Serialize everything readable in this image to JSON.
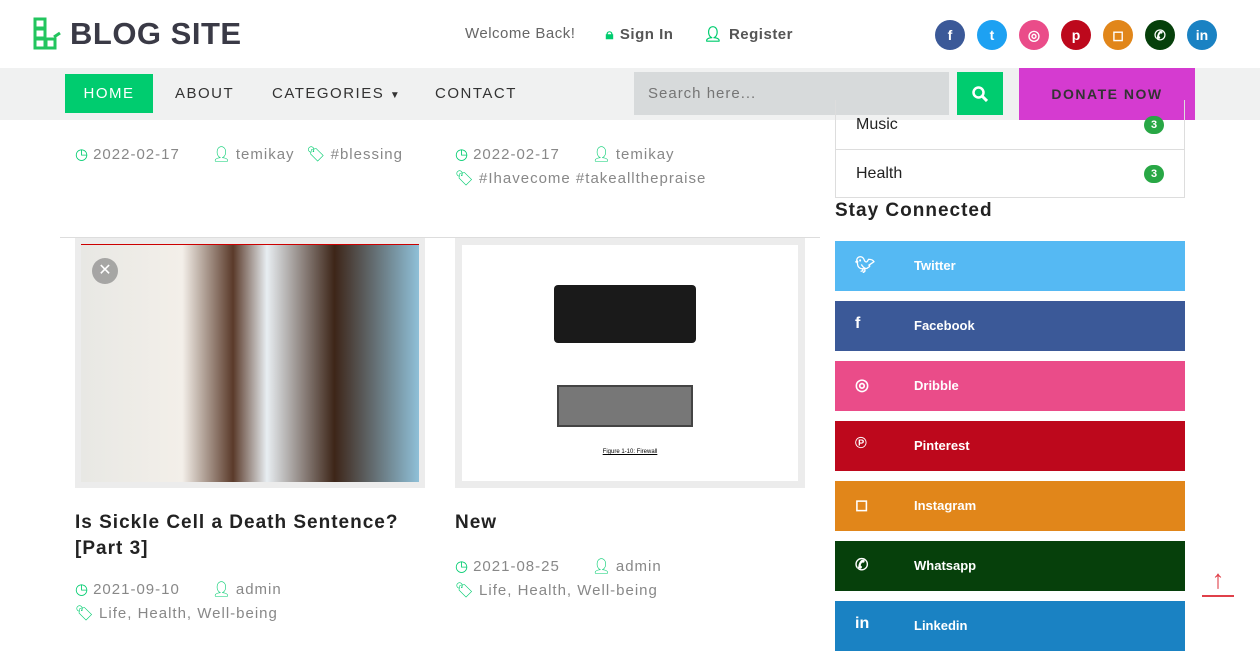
{
  "header": {
    "logo": "BLOG SITE",
    "welcome": "Welcome Back!",
    "sign_in": "Sign In",
    "register": "Register"
  },
  "socials": [
    {
      "name": "facebook",
      "glyph": "f",
      "color": "#3b5998"
    },
    {
      "name": "twitter",
      "glyph": "t",
      "color": "#1da1f2"
    },
    {
      "name": "dribbble",
      "glyph": "◎",
      "color": "#ea4c89"
    },
    {
      "name": "pinterest",
      "glyph": "p",
      "color": "#bd081c"
    },
    {
      "name": "instagram",
      "glyph": "◻",
      "color": "#e1861a"
    },
    {
      "name": "whatsapp",
      "glyph": "✆",
      "color": "#06400b"
    },
    {
      "name": "linkedin",
      "glyph": "in",
      "color": "#1a82c3"
    }
  ],
  "nav": {
    "home": "HOME",
    "about": "ABOUT",
    "categories": "CATEGORIES",
    "contact": "CONTACT",
    "search_placeholder": "Search here...",
    "donate": "DONATE NOW"
  },
  "posts_top": [
    {
      "date": "2022-02-17",
      "author": "temikay",
      "tags": "#blessing"
    },
    {
      "date": "2022-02-17",
      "author": "temikay",
      "tags": "#Ihavecome #takeallthepraise"
    }
  ],
  "posts": [
    {
      "title": "Is Sickle Cell a Death Sentence? [Part 3]",
      "date": "2021-09-10",
      "author": "admin",
      "tags": "Life, Health, Well-being"
    },
    {
      "title": "New",
      "date": "2021-08-25",
      "author": "admin",
      "tags": "Life, Health, Well-being",
      "image_caption": "Figure 1-10: Firewall"
    }
  ],
  "categories": [
    {
      "name": "Music",
      "count": "3"
    },
    {
      "name": "Health",
      "count": "3"
    }
  ],
  "stay_connected": {
    "title": "Stay Connected",
    "items": [
      {
        "label": "Twitter",
        "color": "#55b9f3"
      },
      {
        "label": "Facebook",
        "color": "#3b5998"
      },
      {
        "label": "Dribble",
        "color": "#ea4c89"
      },
      {
        "label": "Pinterest",
        "color": "#bd081c"
      },
      {
        "label": "Instagram",
        "color": "#e1861a"
      },
      {
        "label": "Whatsapp",
        "color": "#06400b"
      },
      {
        "label": "Linkedin",
        "color": "#1a82c3"
      }
    ]
  }
}
